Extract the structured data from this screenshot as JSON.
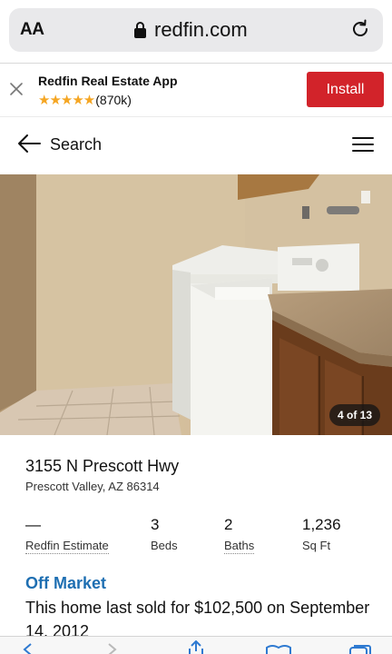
{
  "browser": {
    "aa_label": "AA",
    "domain": "redfin.com"
  },
  "app_banner": {
    "title": "Redfin Real Estate App",
    "stars": "★★★★★",
    "rating_count": "(870k)",
    "install_label": "Install",
    "install_color": "#d2232a"
  },
  "nav": {
    "back_label": "Search"
  },
  "photo": {
    "counter": "4 of 13"
  },
  "property": {
    "street": "3155 N Prescott Hwy",
    "city_line": "Prescott Valley, AZ 86314"
  },
  "stats": [
    {
      "value": "—",
      "label": "Redfin Estimate"
    },
    {
      "value": "3",
      "label": "Beds"
    },
    {
      "value": "2",
      "label": "Baths"
    },
    {
      "value": "1,236",
      "label": "Sq Ft"
    }
  ],
  "status": {
    "title": "Off Market",
    "title_color": "#1f6fb2",
    "text": "This home last sold for $102,500 on September 14, 2012"
  },
  "icons": {
    "lock": "lock-icon",
    "reload": "reload-icon",
    "close": "close-icon",
    "back": "back-arrow-icon",
    "menu": "hamburger-menu-icon"
  }
}
